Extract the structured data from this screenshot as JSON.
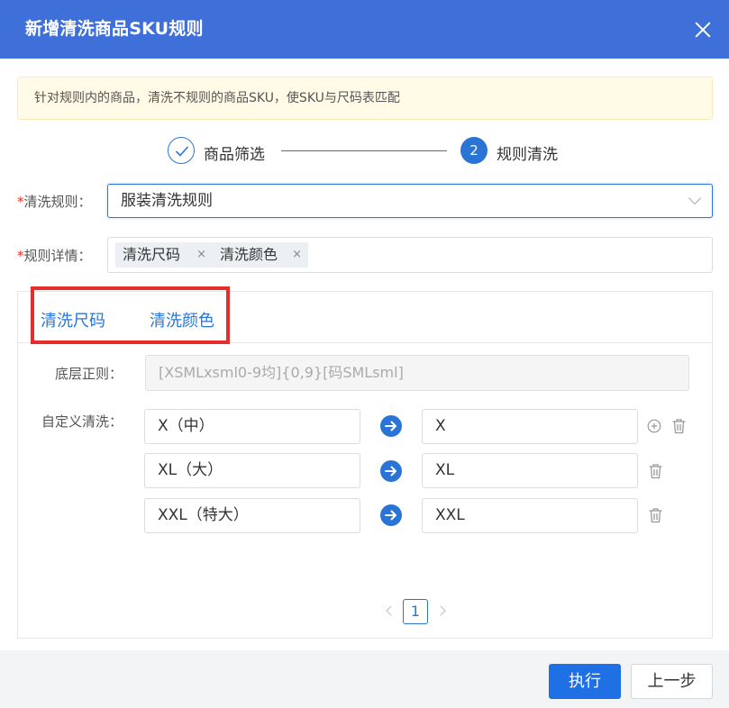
{
  "dialog": {
    "title": "新增清洗商品SKU规则"
  },
  "notice": {
    "text": "针对规则内的商品，清洗不规则的商品SKU，使SKU与尺码表匹配"
  },
  "steps": [
    {
      "label": "商品筛选",
      "status": "done"
    },
    {
      "label": "规则清洗",
      "number": "2",
      "status": "active"
    }
  ],
  "form": {
    "required_mark": "*",
    "rule_label": "清洗规则：",
    "rule_value": "服装清洗规则",
    "detail_label": "规则详情：",
    "detail_tags": [
      "清洗尺码",
      "清洗颜色"
    ]
  },
  "tabs": [
    {
      "label": "清洗尺码"
    },
    {
      "label": "清洗颜色"
    }
  ],
  "panel": {
    "base_rule_label": "底层正则：",
    "base_rule_value": "[XSMLxsml0-9均]{0,9}[码SMLsml]",
    "custom_label": "自定义清洗：",
    "mappings": [
      {
        "from": "X（中）",
        "to": "X"
      },
      {
        "from": "XL（大）",
        "to": "XL"
      },
      {
        "from": "XXL（特大）",
        "to": "XXL"
      }
    ]
  },
  "pagination": {
    "current": "1"
  },
  "footer": {
    "execute_label": "执行",
    "prev_label": "上一步"
  },
  "colors": {
    "header_bg": "#3f70d9",
    "accent": "#2a74d6",
    "primary_button": "#1f6fe5",
    "highlight_box": "#e72c2c",
    "notice_bg": "#fffbe6"
  },
  "icons": {
    "close": "close-icon",
    "check": "check-icon",
    "arrow": "arrow-right-circle-icon",
    "add": "plus-circle-icon",
    "delete": "trash-icon"
  }
}
